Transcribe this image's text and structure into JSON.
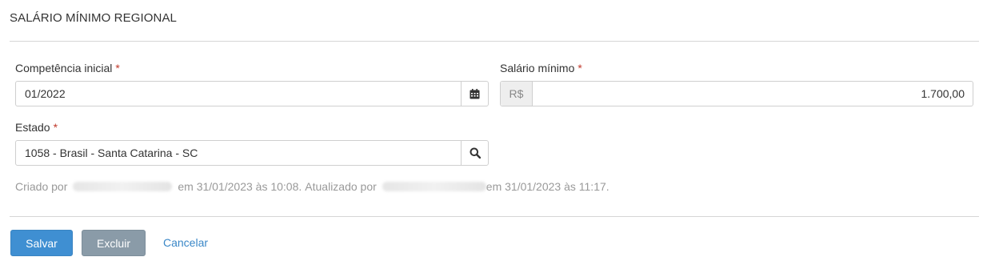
{
  "page": {
    "title": "SALÁRIO MÍNIMO REGIONAL"
  },
  "form": {
    "competencia": {
      "label": "Competência inicial",
      "required_mark": "*",
      "value": "01/2022",
      "icon": "calendar-icon"
    },
    "salario": {
      "label": "Salário mínimo",
      "required_mark": "*",
      "prefix": "R$",
      "value": "1.700,00"
    },
    "estado": {
      "label": "Estado",
      "required_mark": "*",
      "value": "1058 - Brasil - Santa Catarina - SC",
      "icon": "search-icon"
    }
  },
  "audit": {
    "created_prefix": "Criado por",
    "created_suffix": "em 31/01/2023 às 10:08.",
    "updated_prefix": "Atualizado por",
    "updated_suffix": "em 31/01/2023 às 11:17."
  },
  "actions": {
    "save_label": "Salvar",
    "delete_label": "Excluir",
    "cancel_label": "Cancelar"
  },
  "colors": {
    "primary": "#3f8fd2",
    "secondary": "#8a9ba8",
    "link": "#3a87c7",
    "required": "#c0392b"
  }
}
